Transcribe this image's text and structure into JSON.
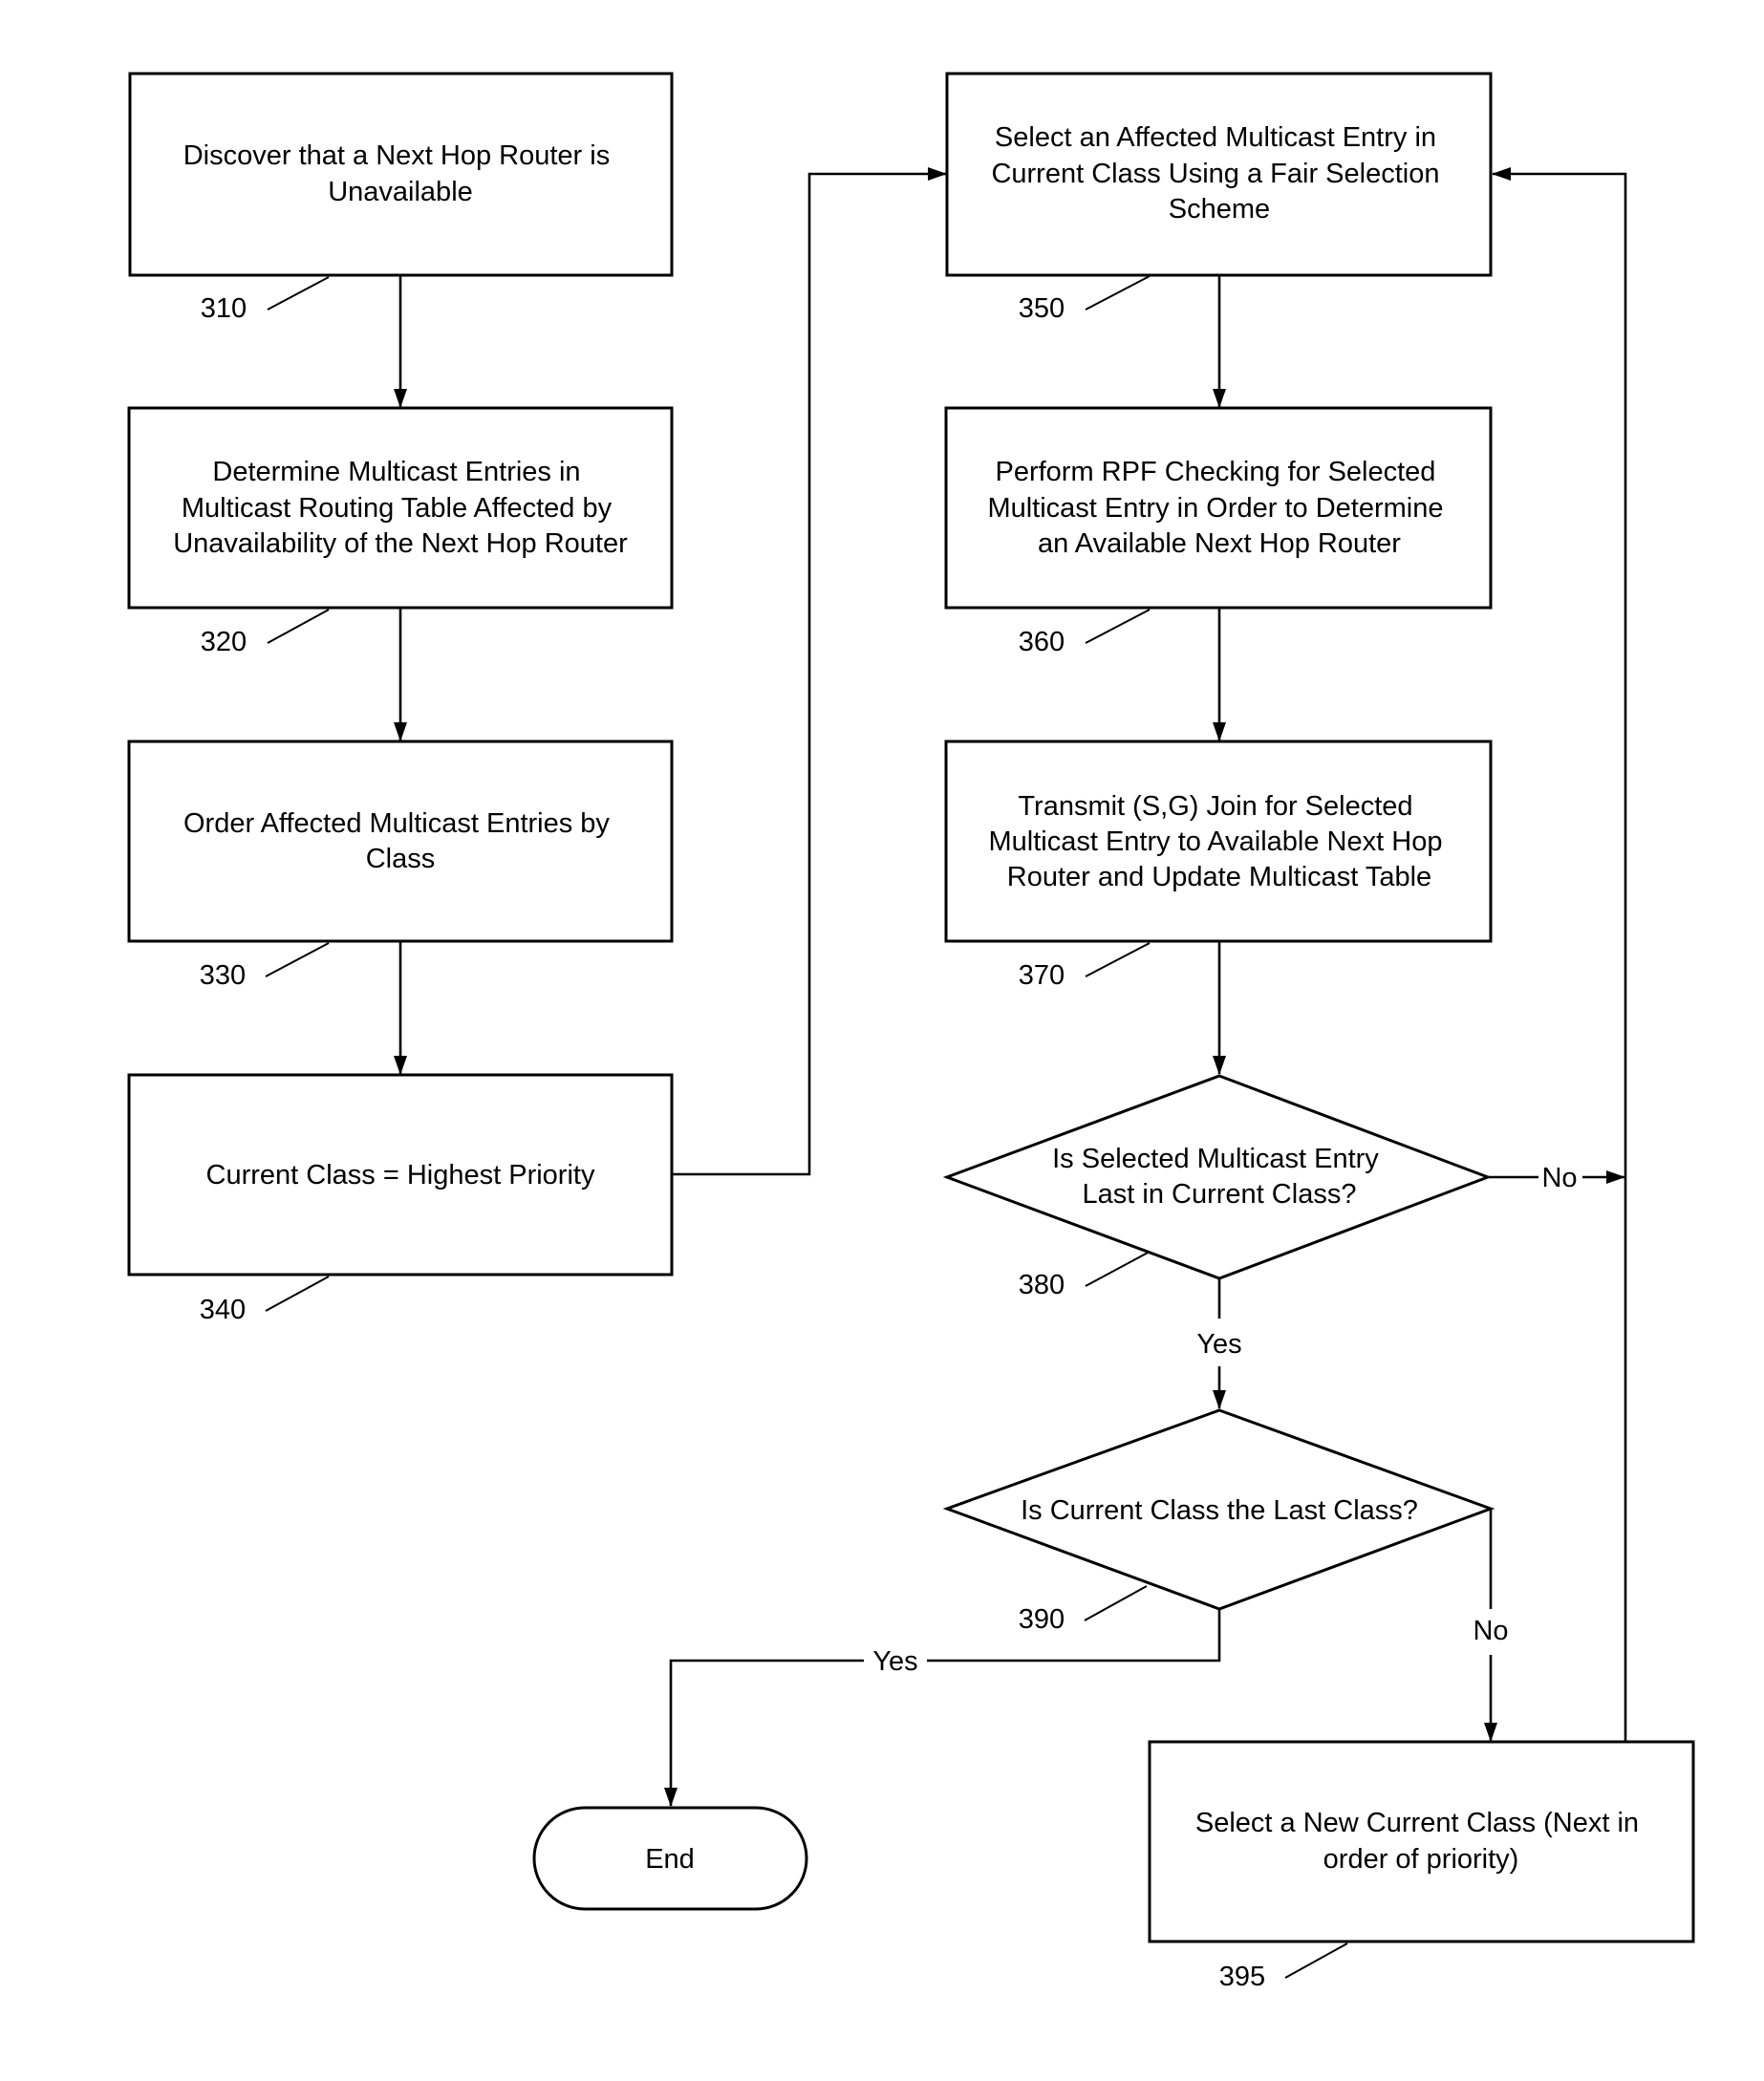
{
  "diagram": {
    "type": "flowchart",
    "steps": {
      "s310": {
        "ref": "310",
        "lines": [
          "Discover that a Next Hop Router is",
          "Unavailable"
        ]
      },
      "s320": {
        "ref": "320",
        "lines": [
          "Determine Multicast Entries in",
          "Multicast Routing Table Affected by",
          "Unavailability of the Next Hop Router"
        ]
      },
      "s330": {
        "ref": "330",
        "lines": [
          "Order Affected Multicast Entries by",
          "Class"
        ]
      },
      "s340": {
        "ref": "340",
        "lines": [
          "Current Class = Highest Priority"
        ]
      },
      "s350": {
        "ref": "350",
        "lines": [
          "Select an Affected Multicast Entry in",
          "Current Class Using a Fair Selection",
          "Scheme"
        ]
      },
      "s360": {
        "ref": "360",
        "lines": [
          "Perform RPF Checking for Selected",
          "Multicast Entry in Order to Determine",
          "an Available Next Hop Router"
        ]
      },
      "s370": {
        "ref": "370",
        "lines": [
          "Transmit (S,G) Join for Selected",
          "Multicast Entry to Available Next Hop",
          "Router and Update Multicast Table"
        ]
      },
      "d380": {
        "ref": "380",
        "lines": [
          "Is Selected Multicast Entry",
          "Last in Current Class?"
        ]
      },
      "d390": {
        "ref": "390",
        "lines": [
          "Is Current Class the Last Class?"
        ]
      },
      "s395": {
        "ref": "395",
        "lines": [
          "Select a New Current Class (Next in",
          "order of priority)"
        ]
      },
      "end": {
        "lines": [
          "End"
        ]
      }
    },
    "edge_labels": {
      "d380_no": "No",
      "d380_yes": "Yes",
      "d390_yes": "Yes",
      "d390_no": "No"
    },
    "edges": [
      {
        "from": "310",
        "to": "320"
      },
      {
        "from": "320",
        "to": "330"
      },
      {
        "from": "330",
        "to": "340"
      },
      {
        "from": "340",
        "to": "350"
      },
      {
        "from": "350",
        "to": "360"
      },
      {
        "from": "360",
        "to": "370"
      },
      {
        "from": "370",
        "to": "380"
      },
      {
        "from": "380",
        "to": "350",
        "label": "No"
      },
      {
        "from": "380",
        "to": "390",
        "label": "Yes"
      },
      {
        "from": "390",
        "to": "End",
        "label": "Yes"
      },
      {
        "from": "390",
        "to": "395",
        "label": "No"
      },
      {
        "from": "395",
        "to": "350"
      }
    ]
  }
}
